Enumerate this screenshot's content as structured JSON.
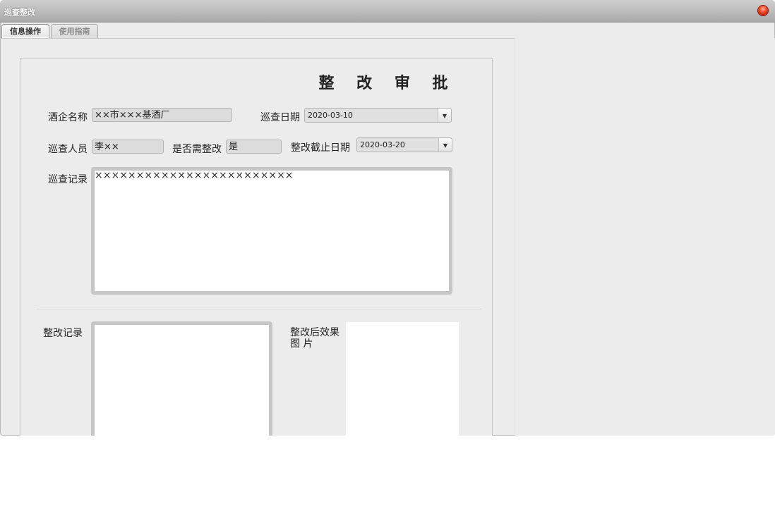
{
  "window": {
    "title": "巡查整改"
  },
  "tabs": [
    {
      "label": "信息操作",
      "active": true
    },
    {
      "label": "使用指南",
      "active": false
    }
  ],
  "form": {
    "title": "整 改 审 批",
    "enterprise_label": "酒企名称",
    "enterprise_value": "××市×××基酒厂",
    "inspect_date_label": "巡查日期",
    "inspect_date_value": "2020-03-10",
    "inspector_label": "巡查人员",
    "inspector_value": "李××",
    "needs_fix_label": "是否需整改",
    "needs_fix_value": "是",
    "deadline_label": "整改截止日期",
    "deadline_value": "2020-03-20",
    "record_label": "巡查记录",
    "record_value": "××××××××××××××××××××××××",
    "fix_record_label": "整改记录",
    "fix_record_value": "",
    "after_image_label_line1": "整改后效果",
    "after_image_label_line2": "图 片"
  }
}
